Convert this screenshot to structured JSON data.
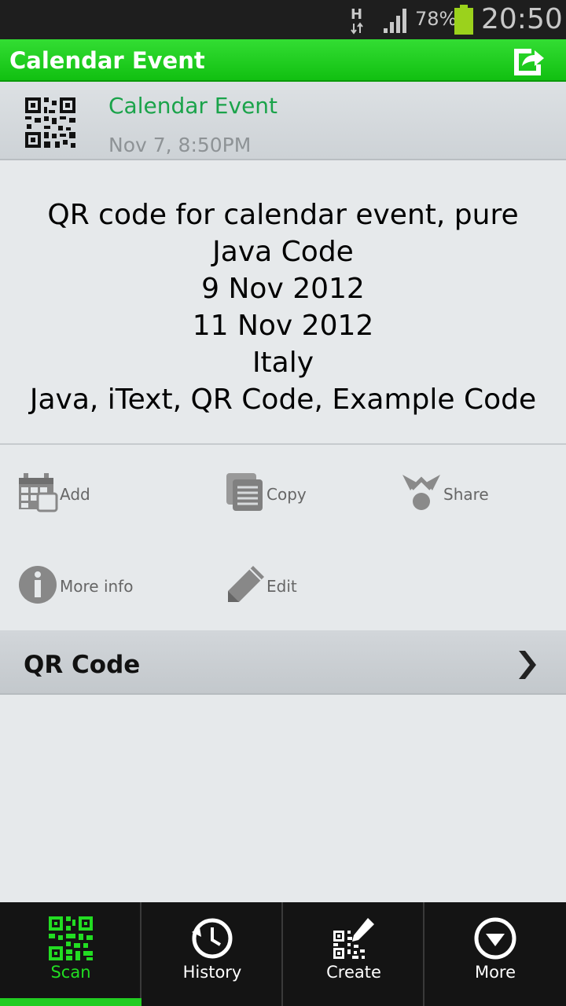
{
  "status_bar": {
    "network": "H",
    "battery_percent": "78%",
    "time": "20:50"
  },
  "action_bar": {
    "title": "Calendar Event",
    "share_icon": "share-export-icon"
  },
  "result_header": {
    "type_label": "Calendar Event",
    "timestamp": "Nov 7, 8:50PM"
  },
  "result_text": {
    "lines": [
      "QR code for calendar event, pure",
      "Java Code",
      "9 Nov 2012",
      "11 Nov 2012",
      "Italy",
      "Java, iText, QR Code, Example Code"
    ]
  },
  "actions": {
    "add": "Add",
    "copy": "Copy",
    "share": "Share",
    "more_info": "More info",
    "edit": "Edit"
  },
  "qr_section": {
    "label": "QR Code"
  },
  "bottom_nav": {
    "tabs": [
      {
        "label": "Scan",
        "icon": "qr-scan-icon",
        "active": true
      },
      {
        "label": "History",
        "icon": "history-clock-icon",
        "active": false
      },
      {
        "label": "Create",
        "icon": "qr-create-icon",
        "active": false
      },
      {
        "label": "More",
        "icon": "more-chevron-icon",
        "active": false
      }
    ]
  },
  "colors": {
    "accent_green": "#22cc22",
    "type_green": "#1aa34a"
  }
}
